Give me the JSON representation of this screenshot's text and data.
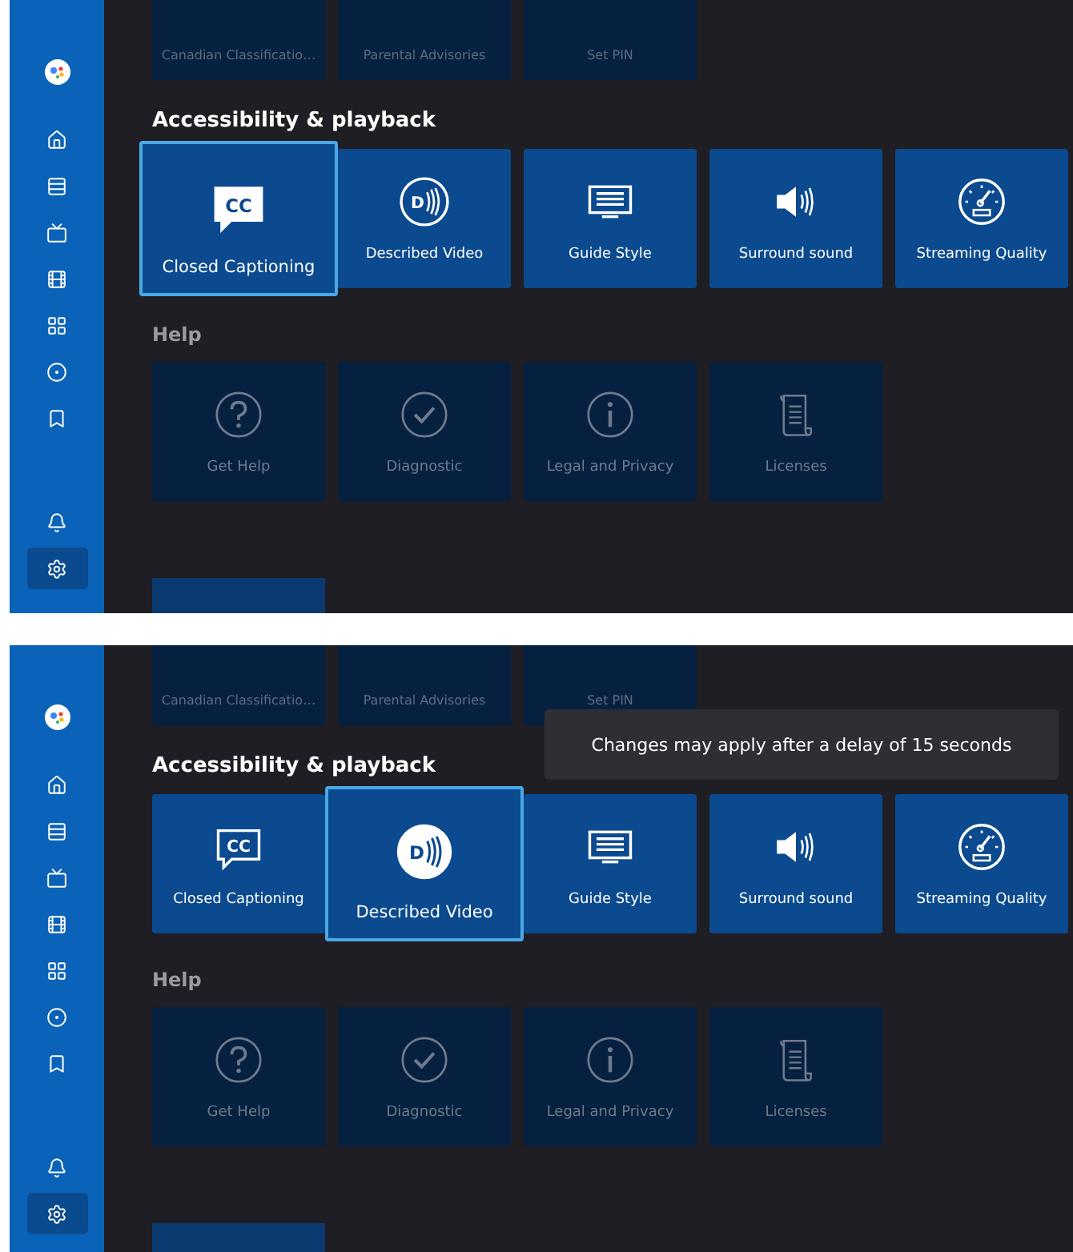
{
  "screens": [
    {
      "sidebar": {
        "items": [
          {
            "selected": false
          },
          {
            "selected": false
          },
          {
            "selected": false
          },
          {
            "selected": false
          },
          {
            "selected": false
          },
          {
            "selected": false
          },
          {
            "selected": false
          },
          {
            "selected": false
          },
          {
            "selected": false
          },
          {
            "selected": true
          }
        ]
      },
      "top_tiles": [
        {
          "label": "Canadian Classificatio…",
          "disabled": true
        },
        {
          "label": "Parental Advisories",
          "disabled": true
        },
        {
          "label": "Set PIN",
          "disabled": true
        }
      ],
      "sections": [
        {
          "title": "Accessibility & playback",
          "tiles": [
            {
              "label": "Closed Captioning",
              "icon_text": "CC",
              "selected": true,
              "disabled": false
            },
            {
              "label": "Described Video",
              "icon_text": "D",
              "selected": false,
              "disabled": false
            },
            {
              "label": "Guide Style",
              "selected": false,
              "disabled": false
            },
            {
              "label": "Surround sound",
              "selected": false,
              "disabled": false
            },
            {
              "label": "Streaming Quality",
              "selected": false,
              "disabled": false
            }
          ]
        },
        {
          "title": "Help",
          "tiles": [
            {
              "label": "Get Help",
              "selected": false,
              "disabled": true
            },
            {
              "label": "Diagnostic",
              "selected": false,
              "disabled": true
            },
            {
              "label": "Legal and Privacy",
              "selected": false,
              "disabled": true
            },
            {
              "label": "Licenses",
              "selected": false,
              "disabled": true
            }
          ]
        }
      ]
    },
    {
      "sidebar": {
        "items": [
          {
            "selected": false
          },
          {
            "selected": false
          },
          {
            "selected": false
          },
          {
            "selected": false
          },
          {
            "selected": false
          },
          {
            "selected": false
          },
          {
            "selected": false
          },
          {
            "selected": false
          },
          {
            "selected": false
          },
          {
            "selected": true
          }
        ]
      },
      "top_tiles": [
        {
          "label": "Canadian Classificatio…",
          "disabled": true
        },
        {
          "label": "Parental Advisories",
          "disabled": true
        },
        {
          "label": "Set PIN",
          "disabled": true
        }
      ],
      "toast": "Changes may apply after a delay of 15 seconds",
      "sections": [
        {
          "title": "Accessibility & playback",
          "tiles": [
            {
              "label": "Closed Captioning",
              "icon_text": "CC",
              "selected": false,
              "disabled": false
            },
            {
              "label": "Described Video",
              "icon_text": "D",
              "selected": true,
              "disabled": false
            },
            {
              "label": "Guide Style",
              "selected": false,
              "disabled": false
            },
            {
              "label": "Surround sound",
              "selected": false,
              "disabled": false
            },
            {
              "label": "Streaming Quality",
              "selected": false,
              "disabled": false
            }
          ]
        },
        {
          "title": "Help",
          "tiles": [
            {
              "label": "Get Help",
              "selected": false,
              "disabled": true
            },
            {
              "label": "Diagnostic",
              "selected": false,
              "disabled": true
            },
            {
              "label": "Legal and Privacy",
              "selected": false,
              "disabled": true
            },
            {
              "label": "Licenses",
              "selected": false,
              "disabled": true
            }
          ]
        }
      ]
    }
  ]
}
